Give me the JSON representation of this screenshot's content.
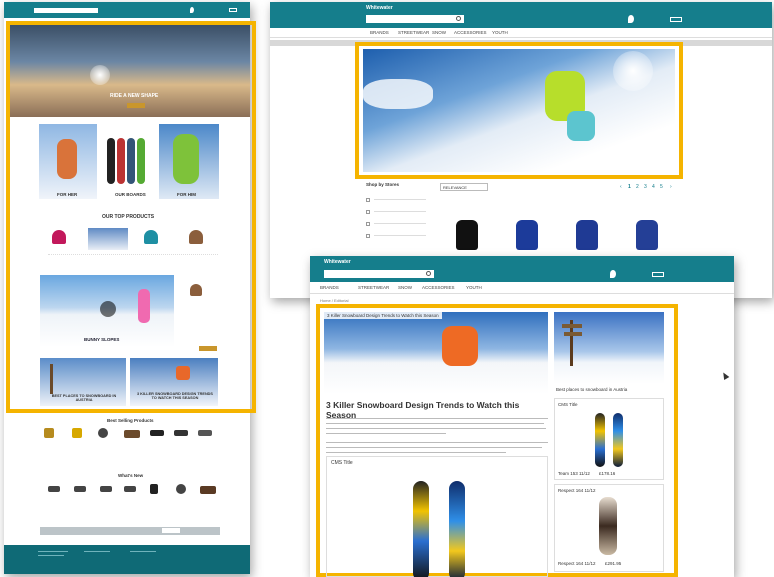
{
  "left_page": {
    "hero_caption": "RIDE A NEW SHAPE",
    "cards": [
      "FOR HER",
      "OUR BOARDS",
      "FOR HIM"
    ],
    "top_products_title": "OUR TOP PRODUCTS",
    "bunny_caption": "BUNNY SLOPES",
    "places_caption": "BEST PLACES TO SNOWBOARD IN AUSTRIA",
    "trends_caption": "3 KILLER SNOWBOARD DESIGN TRENDS TO WATCH THIS SEASON",
    "best_selling_title": "Best Selling Products",
    "whats_new_title": "What's New"
  },
  "top_right_page": {
    "brand": "Whitewater",
    "nav": [
      "BRANDS",
      "STREETWEAR",
      "SNOW",
      "ACCESSORIES",
      "YOUTH"
    ],
    "filter_title": "Shop by Stores",
    "sort_select": "RELEVANCE",
    "pagination": [
      "1",
      "2",
      "3",
      "4",
      "5"
    ]
  },
  "front_page": {
    "brand": "Whitewater",
    "nav": [
      "BRANDS",
      "STREETWEAR",
      "SNOW",
      "ACCESSORIES",
      "YOUTH"
    ],
    "breadcrumb": "Home / Editorial",
    "hero_caption": "3 Killer Snowboard Design Trends to Watch this Season",
    "side_caption": "Best places to snowboard in Austria",
    "article_title": "3 Killer Snowboard Design Trends to Watch this Season",
    "cms_title": "CMS Title",
    "side_cms_title": "CMS Title",
    "product1_name": "Team 153 11/12",
    "product1_price": "£178.16",
    "product2_title": "Respect 164 11/12",
    "product2_name": "Respect 164 11/12",
    "product2_price": "£291.95"
  },
  "colors": {
    "teal": "#157e8c",
    "highlight": "#f5b400"
  }
}
